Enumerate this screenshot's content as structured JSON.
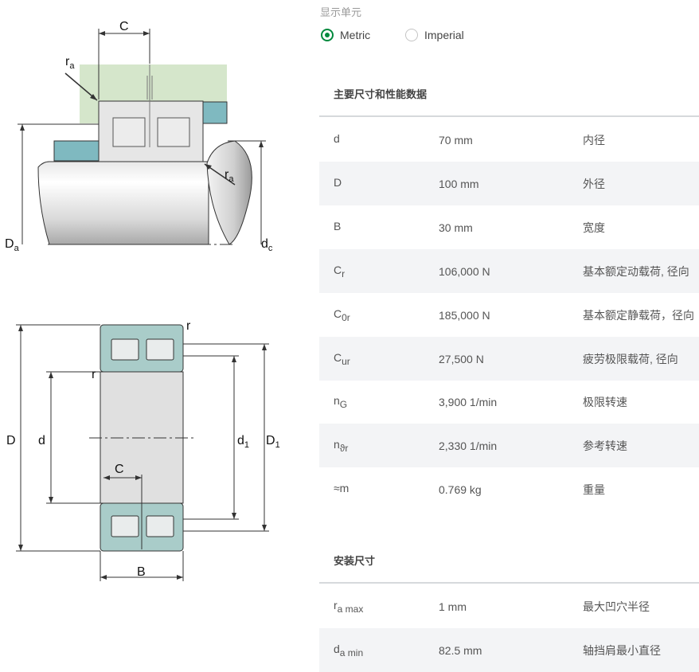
{
  "units": {
    "caption": "显示单元",
    "options": [
      {
        "label": "Metric",
        "selected": true
      },
      {
        "label": "Imperial",
        "selected": false
      }
    ]
  },
  "main_section": {
    "title": "主要尺寸和性能数据",
    "rows": [
      {
        "sym": "d",
        "sub": "",
        "value": "70 mm",
        "desc": "内径"
      },
      {
        "sym": "D",
        "sub": "",
        "value": "100 mm",
        "desc": "外径"
      },
      {
        "sym": "B",
        "sub": "",
        "value": "30 mm",
        "desc": "宽度"
      },
      {
        "sym": "C",
        "sub": "r",
        "value": "106,000 N",
        "desc": "基本额定动载荷, 径向"
      },
      {
        "sym": "C",
        "sub": "0r",
        "value": "185,000 N",
        "desc": "基本额定静载荷，径向"
      },
      {
        "sym": "C",
        "sub": "ur",
        "value": "27,500 N",
        "desc": "疲劳极限载荷, 径向"
      },
      {
        "sym": "n",
        "sub": "G",
        "value": "3,900 1/min",
        "desc": "极限转速"
      },
      {
        "sym": "n",
        "sub": "ϑr",
        "value": "2,330 1/min",
        "desc": "参考转速"
      },
      {
        "sym": "≈m",
        "sub": "",
        "value": "0.769 kg",
        "desc": "重量"
      }
    ]
  },
  "mounting_section": {
    "title": "安装尺寸",
    "rows": [
      {
        "sym": "r",
        "sub": "a max",
        "value": "1 mm",
        "desc": "最大凹穴半径"
      },
      {
        "sym": "d",
        "sub": "a min",
        "value": "82.5 mm",
        "desc": "轴挡肩最小直径"
      }
    ]
  },
  "diagram_labels": {
    "top": {
      "C": "C",
      "ra1": "r",
      "ra1_sub": "a",
      "ra2": "r",
      "ra2_sub": "a",
      "Da": "D",
      "Da_sub": "a",
      "dc": "d",
      "dc_sub": "c"
    },
    "bottom": {
      "r1": "r",
      "r2": "r",
      "D": "D",
      "d": "d",
      "d1": "d",
      "d1_sub": "1",
      "D1": "D",
      "D1_sub": "1",
      "C": "C",
      "B": "B"
    }
  }
}
